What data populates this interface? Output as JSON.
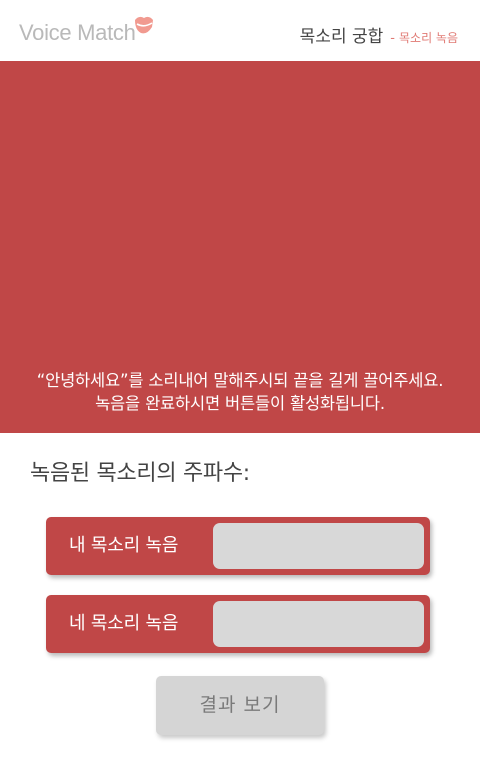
{
  "header": {
    "logo_text": "Voice Match",
    "logo_icon": "lips-icon",
    "title": "목소리 궁합",
    "separator": "-",
    "subtitle": "목소리 녹음"
  },
  "hero": {
    "line1": "“안녕하세요”를 소리내어 말해주시되 끝을 길게 끌어주세요.",
    "line2": "녹음을 완료하시면 버튼들이 활성화됩니다."
  },
  "frequency_label": "녹음된 목소리의 주파수:",
  "recordings": [
    {
      "label": "내 목소리 녹음",
      "frequency": ""
    },
    {
      "label": "네 목소리 녹음",
      "frequency": ""
    }
  ],
  "result_button": {
    "label": "결과 보기",
    "enabled": false
  },
  "colors": {
    "accent": "#c04747",
    "accent_light": "#e07a74",
    "disabled": "#d5d5d5",
    "input_bg": "#d8d8d8"
  }
}
